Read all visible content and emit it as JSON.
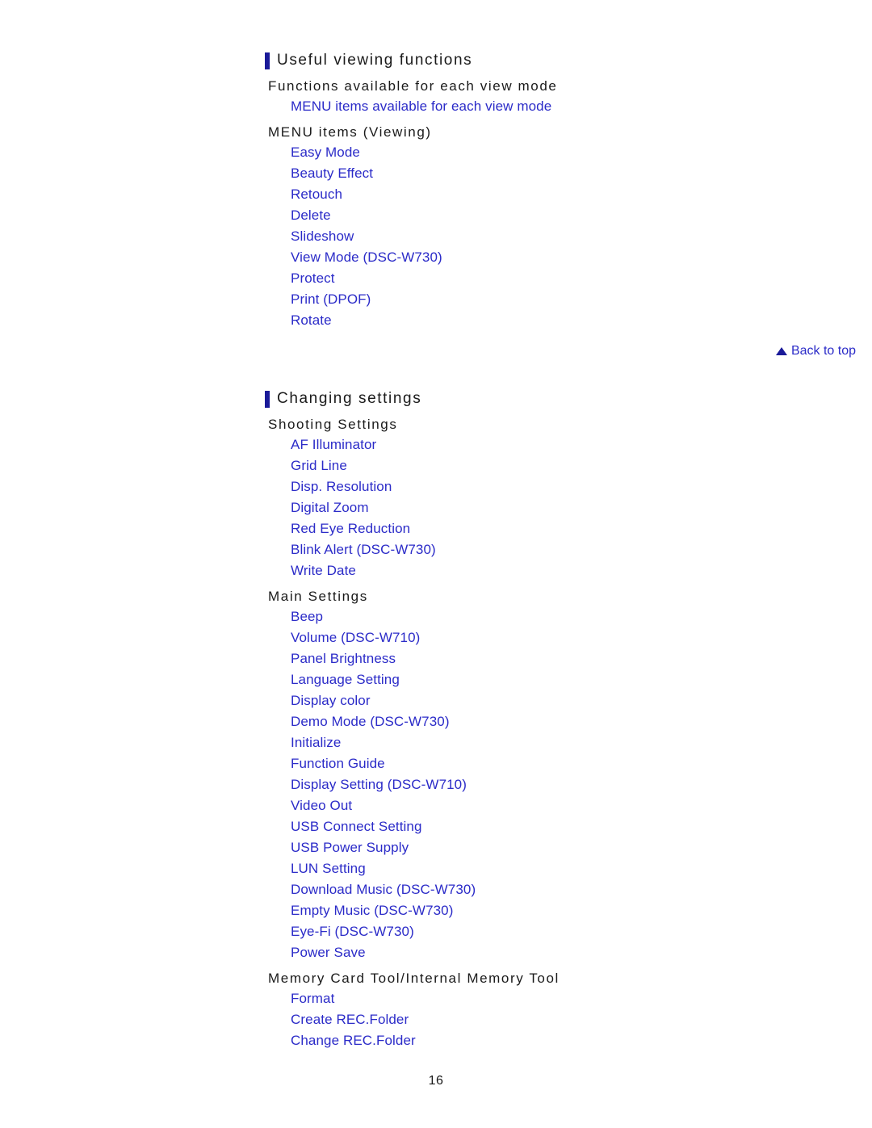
{
  "page": {
    "number": "16",
    "accent_navy": "#1a1a99",
    "link_blue": "#2b2bc8",
    "text_dark": "#1a1a1a"
  },
  "sections": [
    {
      "title": "Useful viewing functions",
      "groups": [
        {
          "heading": "Functions available for each view mode",
          "links": [
            "MENU items available for each view mode"
          ]
        },
        {
          "heading": "MENU items (Viewing)",
          "links": [
            "Easy Mode",
            "Beauty Effect",
            "Retouch",
            "Delete",
            "Slideshow",
            "View Mode (DSC-W730)",
            "Protect",
            "Print (DPOF)",
            "Rotate"
          ]
        }
      ]
    },
    {
      "title": "Changing settings",
      "groups": [
        {
          "heading": "Shooting Settings",
          "links": [
            "AF Illuminator",
            "Grid Line",
            "Disp. Resolution",
            "Digital Zoom",
            "Red Eye Reduction",
            "Blink Alert (DSC-W730)",
            "Write Date"
          ]
        },
        {
          "heading": "Main Settings",
          "links": [
            "Beep",
            "Volume (DSC-W710)",
            "Panel Brightness",
            "Language Setting",
            "Display color",
            "Demo Mode (DSC-W730)",
            "Initialize",
            "Function Guide",
            "Display Setting (DSC-W710)",
            "Video Out",
            "USB Connect Setting",
            "USB Power Supply",
            "LUN Setting",
            "Download Music (DSC-W730)",
            "Empty Music (DSC-W730)",
            "Eye-Fi (DSC-W730)",
            "Power Save"
          ]
        },
        {
          "heading": "Memory Card Tool/Internal Memory Tool",
          "links": [
            "Format",
            "Create REC.Folder",
            "Change REC.Folder"
          ]
        }
      ]
    }
  ],
  "back_to_top": {
    "label": "Back to top",
    "icon": "triangle-up-icon"
  }
}
